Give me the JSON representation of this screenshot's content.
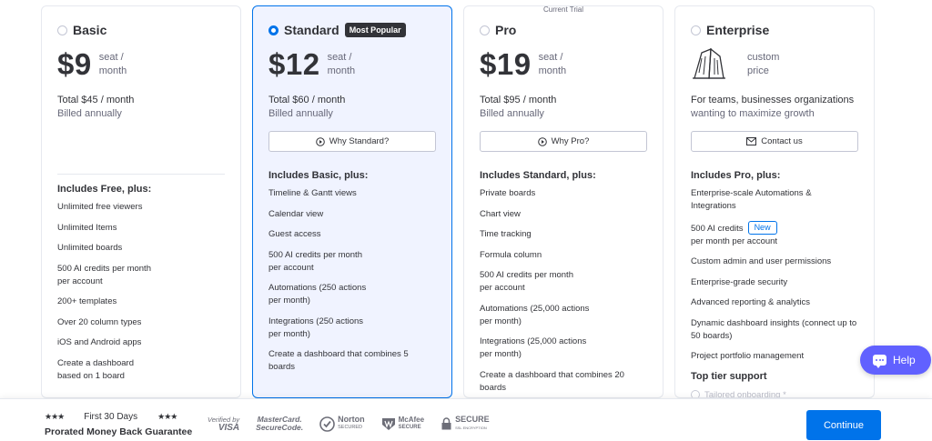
{
  "plans": {
    "basic": {
      "name": "Basic",
      "price": "$9",
      "unit": "seat / month",
      "total": "Total $45 / month",
      "billed": "Billed annually",
      "includes": "Includes Free, plus:",
      "features": [
        "Unlimited free viewers",
        "Unlimited Items",
        "Unlimited boards",
        "500 AI credits per month per account",
        "200+ templates",
        "Over 20 column types",
        "iOS and Android apps",
        "Create a dashboard based on 1 board"
      ]
    },
    "standard": {
      "name": "Standard",
      "badge": "Most Popular",
      "price": "$12",
      "unit": "seat / month",
      "total": "Total $60 / month",
      "billed": "Billed annually",
      "cta": "Why Standard?",
      "includes": "Includes Basic, plus:",
      "features": [
        "Timeline & Gantt views",
        "Calendar view",
        "Guest access",
        "500 AI credits per month per account",
        "Automations (250 actions per month)",
        "Integrations (250 actions per month)",
        "Create a dashboard that combines 5 boards"
      ]
    },
    "pro": {
      "trial_label": "Current Trial",
      "name": "Pro",
      "price": "$19",
      "unit": "seat / month",
      "total": "Total $95 / month",
      "billed": "Billed annually",
      "cta": "Why Pro?",
      "includes": "Includes Standard, plus:",
      "features": [
        "Private boards",
        "Chart view",
        "Time tracking",
        "Formula column",
        "500 AI credits per month per account",
        "Automations (25,000 actions per month)",
        "Integrations (25,000 actions per month)",
        "Create a dashboard that combines 20 boards"
      ]
    },
    "enterprise": {
      "name": "Enterprise",
      "unit": "custom price",
      "total": "For teams, businesses organizations",
      "billed": "wanting to maximize growth",
      "cta": "Contact us",
      "includes": "Includes Pro, plus:",
      "features": [
        "Enterprise-scale Automations & Integrations",
        "500 AI credits",
        "per month per account",
        "Custom admin and user permissions",
        "Enterprise-grade security",
        "Advanced reporting & analytics",
        "Dynamic dashboard insights (connect up to 50 boards)",
        "Project portfolio management"
      ],
      "new_badge": "New",
      "top_tier": "Top tier support",
      "onboarding": "Tailored onboarding *"
    }
  },
  "help": {
    "label": "Help"
  },
  "footer": {
    "stars": "★★★",
    "first_days": "First 30 Days",
    "guarantee": "Prorated Money Back Guarantee",
    "badges": [
      "Verified by VISA",
      "MasterCard. SecureCode.",
      "Norton SECURED",
      "McAfee SECURE",
      "SECURE SSL ENCRYPTION"
    ],
    "continue": "Continue"
  },
  "colors": {
    "accent": "#0073ea",
    "help": "#6161ff",
    "text": "#323338",
    "muted": "#676879"
  }
}
